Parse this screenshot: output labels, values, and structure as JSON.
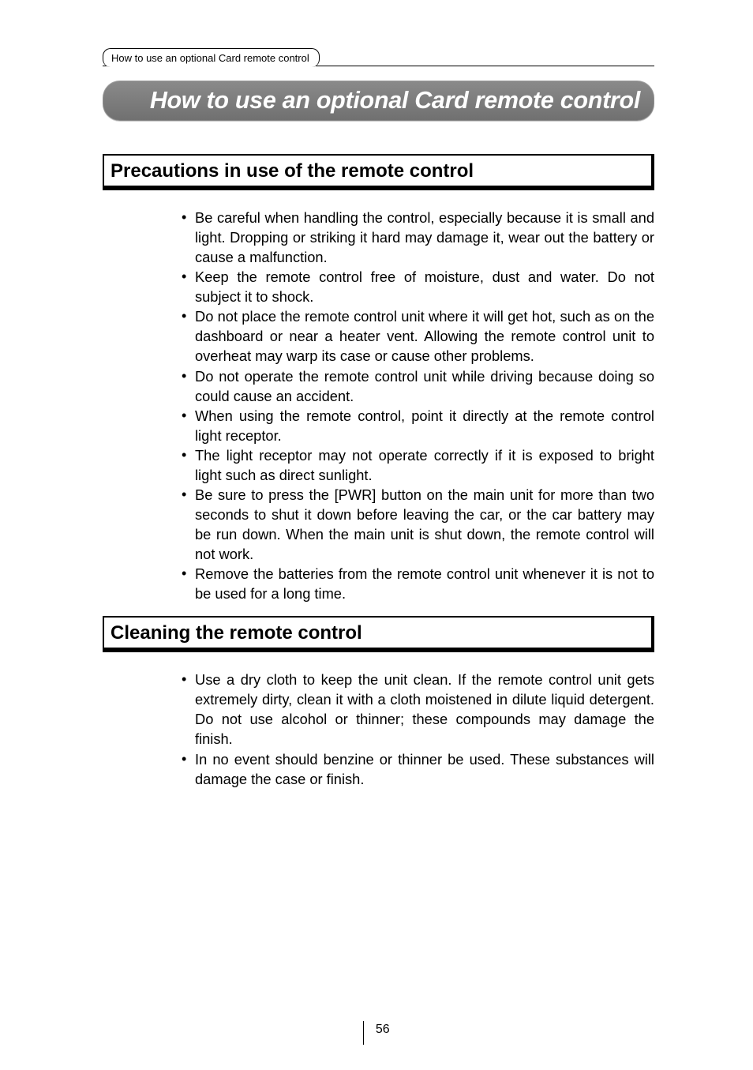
{
  "header": {
    "tab_label": "How to use an optional Card remote control"
  },
  "title": "How to use an optional Card remote control",
  "sections": {
    "precautions": {
      "heading": "Precautions in use of the remote control",
      "items": [
        "Be careful when handling the control, especially because it is small and light. Dropping or striking it hard may damage it, wear out the battery or cause a malfunction.",
        "Keep the remote control free of moisture, dust and water. Do not subject it to shock.",
        "Do not place the remote control unit where it will get hot, such as on the dashboard or near a heater vent.  Allowing the remote control unit to overheat may warp its case or cause other problems.",
        "Do not operate the remote control unit while driving because doing so could cause an accident.",
        "When using the remote control, point it directly at the remote control light receptor.",
        "The light receptor may not operate correctly if it is exposed to bright light such as direct sunlight.",
        "Be sure to press the [PWR] button on the main unit for more than two seconds to shut it down before leaving the car, or the car battery may be run down. When the main unit is shut down, the remote control will not work.",
        "Remove the batteries from the remote control unit whenever it is not to be used for a long time."
      ]
    },
    "cleaning": {
      "heading": "Cleaning the remote control",
      "items": [
        "Use a dry cloth to keep the unit clean.  If the remote control unit gets extremely dirty, clean it with a cloth moistened in dilute liquid detergent.  Do not use alcohol or thinner; these compounds may damage the finish.",
        "In no event should benzine or thinner be used. These substances will damage the case or finish."
      ]
    }
  },
  "page_number": "56"
}
